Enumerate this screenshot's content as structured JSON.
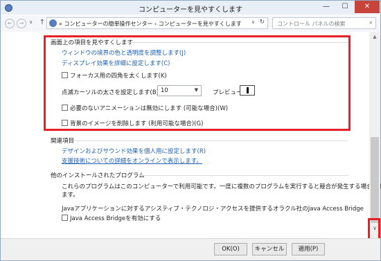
{
  "window": {
    "title": "コンピューターを見やすくします",
    "minimize": "—",
    "maximize": "☐",
    "close": "✕"
  },
  "addressbar": {
    "back": "←",
    "forward": "→",
    "dropdown": "∨",
    "up": "↑",
    "path_prefix": "«",
    "path_part1": "コンピューターの簡単操作センター",
    "path_sep": "›",
    "path_part2": "コンピューターを見やすくします",
    "path_dropdown": "∨",
    "refresh": "↻",
    "search_placeholder": "コントロール パネルの検索",
    "search_icon": "⌕"
  },
  "sections": {
    "display": {
      "heading": "画面上の項目を見やすくします",
      "link_window_color": "ウィンドウの境界の色と透明度を調整します(J)",
      "link_display_effects": "ディスプレイ効果を詳細に設定します(C)",
      "chk_focus_rect": "フォーカス用の四角を太くします(K)",
      "cursor_label": "点滅カーソルの太さを設定します(B):",
      "cursor_value": "10",
      "preview_label": "プレビュー:",
      "chk_animations": "必要のないアニメーションは無効にします (可能な場合)(W)",
      "chk_background": "背景のイメージを削除します (利用可能な場合)(G)"
    },
    "related": {
      "heading": "関連項目",
      "link_personalize": "デザインおよびサウンド効果を個人用に設定します(R)",
      "link_online": "支援技術についての詳細をオンラインで表示します。"
    },
    "other": {
      "heading": "他のインストールされたプログラム",
      "description_line1": "これらのプログラムはこのコンピューターで利用可能です。一度に複数のプログラムを実行すると競合が発生する場合があり",
      "description_line2": "ます。",
      "java_desc": "Javaアプリケーションに対するアシスティブ・テクノロジ・アクセスを提供するオラクル社のJava Access Bridge",
      "chk_java": "Java Access Bridgeを有効にする"
    }
  },
  "scrollbar": {
    "up_arrow": "▲",
    "down_arrow": "∨"
  },
  "footer": {
    "ok": "OK(O)",
    "cancel": "キャンセル",
    "apply": "適用(P)"
  },
  "colors": {
    "link": "#1a5fb4",
    "highlight": "#e52026",
    "close_button": "#c7443a"
  }
}
